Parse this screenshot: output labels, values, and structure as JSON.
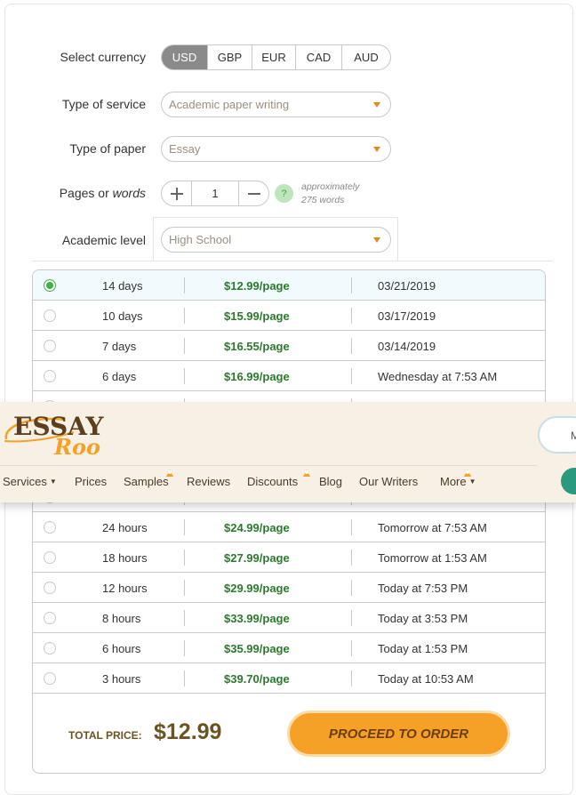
{
  "form": {
    "currency_label": "Select currency",
    "currencies": [
      "USD",
      "GBP",
      "EUR",
      "CAD",
      "AUD"
    ],
    "selected_currency": "USD",
    "service_label": "Type of service",
    "service_value": "Academic paper writing",
    "paper_label": "Type of paper",
    "paper_value": "Essay",
    "pages_label_pre": "Pages or ",
    "pages_label_em": "words",
    "pages_value": "1",
    "hint_icon": "?",
    "hint_line1": "approximately",
    "hint_line2": "275 words",
    "level_label": "Academic level",
    "level_value": "High School"
  },
  "deadlines": [
    {
      "deadline": "14 days",
      "price": "$12.99/page",
      "date": "03/21/2019",
      "selected": true
    },
    {
      "deadline": "10 days",
      "price": "$15.99/page",
      "date": "03/17/2019"
    },
    {
      "deadline": "7 days",
      "price": "$16.55/page",
      "date": "03/14/2019"
    },
    {
      "deadline": "6 days",
      "price": "$16.99/page",
      "date": "Wednesday at 7:53 AM"
    },
    {
      "deadline": "",
      "price": "",
      "date": ""
    },
    {
      "deadline": "",
      "price": "",
      "date": ""
    },
    {
      "deadline": "",
      "price": "",
      "date": ""
    },
    {
      "deadline": "",
      "price": "",
      "date": ""
    },
    {
      "deadline": "24 hours",
      "price": "$24.99/page",
      "date": "Tomorrow at 7:53 AM"
    },
    {
      "deadline": "18 hours",
      "price": "$27.99/page",
      "date": "Tomorrow at 1:53 AM"
    },
    {
      "deadline": "12 hours",
      "price": "$29.99/page",
      "date": "Today at 7:53 PM"
    },
    {
      "deadline": "8 hours",
      "price": "$33.99/page",
      "date": "Today at 3:53 PM"
    },
    {
      "deadline": "6 hours",
      "price": "$35.99/page",
      "date": "Today at 1:53 PM"
    },
    {
      "deadline": "3 hours",
      "price": "$39.70/page",
      "date": "Today at 10:53 AM"
    }
  ],
  "total": {
    "label": "TOTAL PRICE:",
    "value": "$12.99"
  },
  "proceed_label": "PROCEED TO ORDER",
  "header": {
    "logo_line1": "ESSAY",
    "logo_line2": "Roo",
    "nav": [
      {
        "label": "Services",
        "dropdown": true,
        "badge": false
      },
      {
        "label": "Prices",
        "dropdown": false,
        "badge": false
      },
      {
        "label": "Samples",
        "dropdown": false,
        "badge": true
      },
      {
        "label": "Reviews",
        "dropdown": false,
        "badge": false
      },
      {
        "label": "Discounts",
        "dropdown": false,
        "badge": true
      },
      {
        "label": "Blog",
        "dropdown": false,
        "badge": false
      },
      {
        "label": "Our Writers",
        "dropdown": false,
        "badge": false
      },
      {
        "label": "More",
        "dropdown": true,
        "badge": true
      }
    ],
    "right_button_fragment": "M"
  },
  "colors": {
    "accent": "#f5a128",
    "price": "#2b7a2d",
    "selected_radio": "#41b049",
    "brand_brown": "#6b3d10"
  }
}
